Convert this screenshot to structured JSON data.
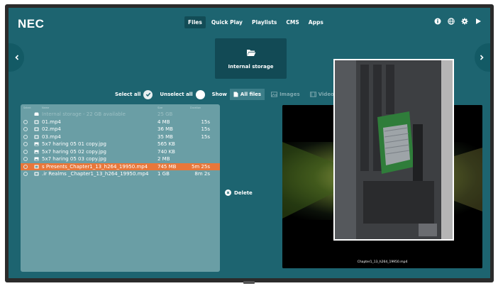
{
  "brand": {
    "logo": "NEC"
  },
  "nav": {
    "items": [
      "Files",
      "Quick Play",
      "Playlists",
      "CMS",
      "Apps"
    ],
    "active_index": 0
  },
  "top_icons": [
    "info-icon",
    "globe-icon",
    "settings-icon",
    "play-icon"
  ],
  "storage": {
    "label": "Internal storage",
    "icon": "folder-icon"
  },
  "controls": {
    "select_all": "Select all",
    "unselect_all": "Unselect all",
    "show": "Show"
  },
  "filters": [
    {
      "label": "All files",
      "icon": "file-icon",
      "active": true
    },
    {
      "label": "Images",
      "icon": "image-icon",
      "active": false
    },
    {
      "label": "Video",
      "icon": "film-icon",
      "active": false
    }
  ],
  "file_table": {
    "columns": [
      "Select",
      "Name",
      "Size",
      "Duration"
    ],
    "rows": [
      {
        "name": "Internal storage - 22 GB available",
        "size": "25 GB",
        "duration": "",
        "type": "drive-icon",
        "disabled": true
      },
      {
        "name": "01.mp4",
        "size": "4 MB",
        "duration": "15s",
        "type": "video-icon"
      },
      {
        "name": "02.mp4",
        "size": "36 MB",
        "duration": "15s",
        "type": "video-icon"
      },
      {
        "name": "03.mp4",
        "size": "35 MB",
        "duration": "15s",
        "type": "video-icon"
      },
      {
        "name": "5x7 haring 05 01 copy.jpg",
        "size": "565 KB",
        "duration": "",
        "type": "image-icon"
      },
      {
        "name": "5x7 haring 05 02 copy.jpg",
        "size": "740 KB",
        "duration": "",
        "type": "image-icon"
      },
      {
        "name": "5x7 haring 05 03 copy.jpg",
        "size": "2 MB",
        "duration": "",
        "type": "image-icon"
      },
      {
        "name": "s Presents_Chapter1_13_h264_19950.mp4",
        "size": "745 MB",
        "duration": "5m 25s",
        "type": "video-icon",
        "selected": true
      },
      {
        "name": ".ir Realms _Chapter1_13_h264_19950.mp4",
        "size": "1 GB",
        "duration": "8m 2s",
        "type": "video-icon"
      }
    ]
  },
  "actions": {
    "delete": "Delete"
  },
  "preview": {
    "caption": "Chapter1_13_h264_19950.mp4"
  },
  "colors": {
    "screen_bg": "#1d6470",
    "panel_bg": "#6a9ea5",
    "selected_row": "#e8773a",
    "nav_active": "#124c56"
  }
}
